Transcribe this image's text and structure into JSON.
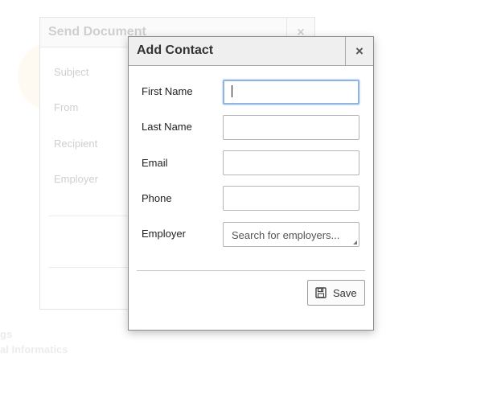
{
  "background_dialog": {
    "title": "Send Document",
    "close_glyph": "×",
    "labels": [
      "Subject",
      "From",
      "Recipient",
      "Employer"
    ],
    "footer_texts": [
      "gs",
      "al Informatics"
    ]
  },
  "dialog": {
    "title": "Add Contact",
    "close_glyph": "×",
    "fields": {
      "first_name": {
        "label": "First Name",
        "value": ""
      },
      "last_name": {
        "label": "Last Name",
        "value": ""
      },
      "email": {
        "label": "Email",
        "value": ""
      },
      "phone": {
        "label": "Phone",
        "value": ""
      },
      "employer": {
        "label": "Employer",
        "placeholder": "Search for employers..."
      }
    },
    "save_label": "Save",
    "save_icon": "floppy-disk-icon"
  }
}
